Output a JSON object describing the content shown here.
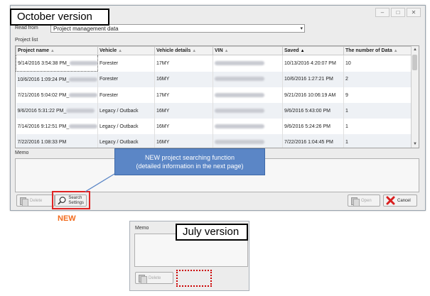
{
  "october": {
    "title": "October version",
    "read_from_label": "Read from",
    "read_from_value": "Project management data",
    "project_list_label": "Project list",
    "columns": [
      "Project name",
      "Vehicle",
      "Vehicle details",
      "VIN",
      "Saved",
      "The number of Data"
    ],
    "rows": [
      {
        "name": "9/14/2016 3:54:38 PM_",
        "vehicle": "Forester",
        "details": "17MY",
        "saved": "10/13/2016 4:20:07 PM",
        "count": "10"
      },
      {
        "name": "10/6/2016 1:09:24 PM_",
        "vehicle": "Forester",
        "details": "16MY",
        "saved": "10/6/2016 1:27:21 PM",
        "count": "2"
      },
      {
        "name": "7/21/2016 5:04:02 PM_",
        "vehicle": "Forester",
        "details": "17MY",
        "saved": "9/21/2016 10:06:19 AM",
        "count": "9"
      },
      {
        "name": "9/6/2016 5:31:22 PM_",
        "vehicle": "Legacy / Outback",
        "details": "16MY",
        "saved": "9/6/2016 5:43:00 PM",
        "count": "1"
      },
      {
        "name": "7/14/2016 9:12:51 PM_",
        "vehicle": "Legacy / Outback",
        "details": "16MY",
        "saved": "9/6/2016 5:24:26 PM",
        "count": "1"
      },
      {
        "name": "7/22/2016 1:08:33 PM",
        "vehicle": "Legacy / Outback",
        "details": "16MY",
        "saved": "7/22/2016 1:04:45 PM",
        "count": "1"
      }
    ],
    "memo_label": "Memo",
    "delete_label": "Delete",
    "search_label_1": "Search",
    "search_label_2": "Settings",
    "open_label": "Open",
    "cancel_label": "Cancel"
  },
  "annotation": {
    "line1": "NEW project searching function",
    "line2": "(detailed information in the next page)",
    "new_tag": "NEW"
  },
  "july": {
    "title": "July version",
    "memo_label": "Memo",
    "delete_label": "Delete"
  },
  "colors": {
    "highlight": "#e02424",
    "new_tag": "#f26b1d",
    "callout": "#5b86c6"
  }
}
